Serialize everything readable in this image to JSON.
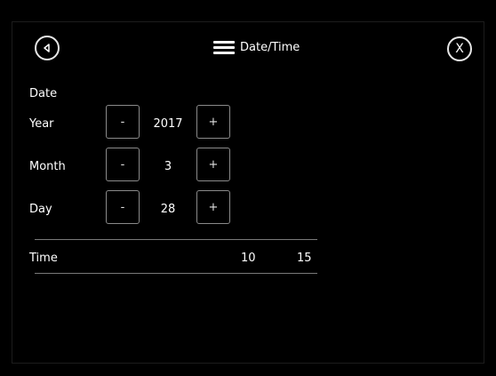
{
  "header": {
    "title": "Date/Time",
    "close_label": "X"
  },
  "date": {
    "section_label": "Date",
    "rows": [
      {
        "label": "Year",
        "value": "2017",
        "minus": "-",
        "plus": "+"
      },
      {
        "label": "Month",
        "value": "3",
        "minus": "-",
        "plus": "+"
      },
      {
        "label": "Day",
        "value": "28",
        "minus": "-",
        "plus": "+"
      }
    ]
  },
  "time": {
    "label": "Time",
    "hour": "10",
    "minute": "15"
  },
  "icons": {
    "back": "back-arrow-icon",
    "menu": "menu-icon"
  }
}
